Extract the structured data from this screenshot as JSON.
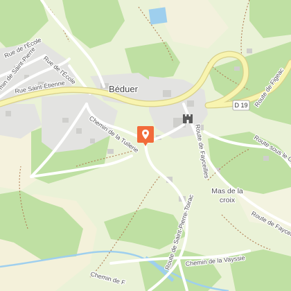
{
  "map": {
    "town": "Béduer",
    "place": {
      "line1": "Mas de la",
      "line2": "croix"
    },
    "route_shield": "D 19",
    "roads": {
      "rue_saint_etienne": "Rue Saint-Étienne",
      "rue_ecole_1": "Rue de l'École",
      "rue_ecole_2": "Rue de l'École",
      "chemin_saint_pierre": "min de Saint-Pierre",
      "chemin_tuilerie": "Chemin de la Tuilerie",
      "route_fayceilles_1": "Route de Fayceilles",
      "route_fayceilles_2": "Route de Fayceilles",
      "route_figeac": "Route de Figeac",
      "route_sous_le_ch": "Route sous le Ch",
      "route_saint_pierre_toirac": "Route de Saint-Pierre-Toirac",
      "chemin_vayssie": "Chemin de la Vayssie",
      "chemin_de_f": "Chemin de F"
    },
    "marker": {
      "icon": "map-pin-icon",
      "color": "#f26b3a"
    },
    "castle_icon": "castle-icon",
    "colors": {
      "meadow": "#eaf2d7",
      "forest": "#bfe0a3",
      "residential": "#e3e3e1",
      "field": "#f5f2dd",
      "main_road_fill": "#f8f4b0",
      "main_road_casing": "#d8d08a",
      "minor_road": "#ffffff",
      "water": "#9ecfee",
      "trail": "#b07c52"
    }
  }
}
